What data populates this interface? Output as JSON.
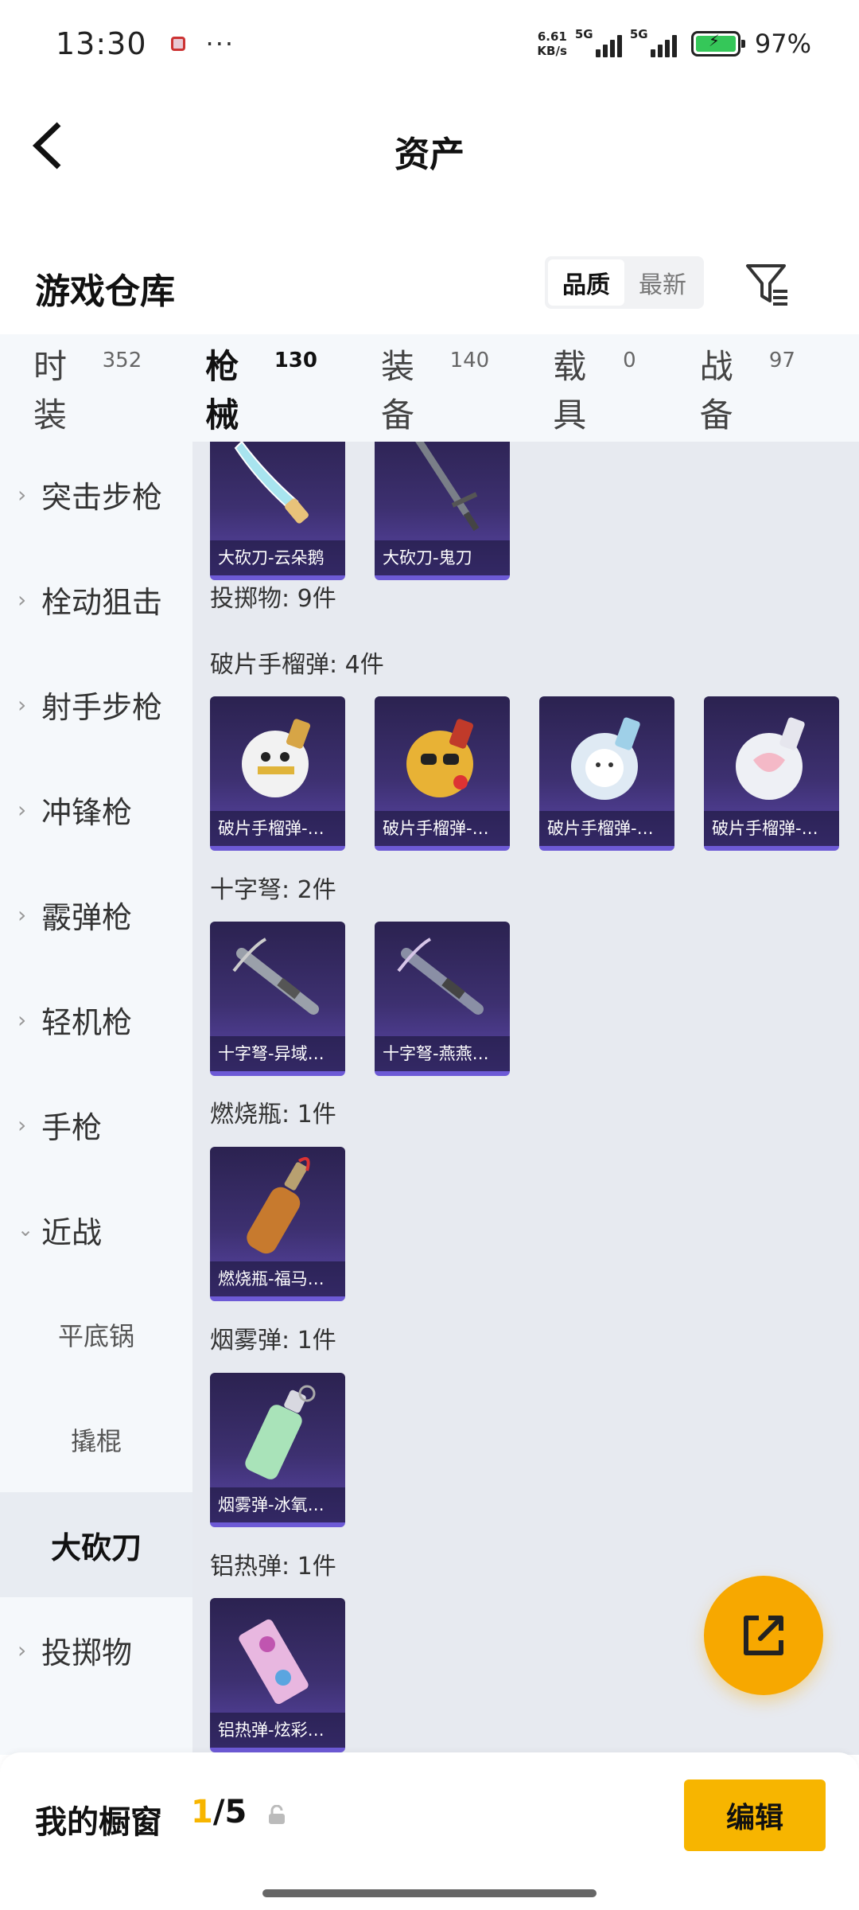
{
  "status_bar": {
    "time": "13:30",
    "dots": "···",
    "net_speed_value": "6.61",
    "net_speed_unit": "KB/s",
    "signal1_tag": "5G",
    "signal2_tag": "5G",
    "battery_pct": "97%"
  },
  "header": {
    "title": "资产"
  },
  "section": {
    "title": "游戏仓库",
    "sort_options": [
      "品质",
      "最新"
    ],
    "sort_selected": "品质"
  },
  "category_tabs": [
    {
      "name": "时装",
      "count": "352"
    },
    {
      "name": "枪械",
      "count": "130",
      "active": true
    },
    {
      "name": "装备",
      "count": "140"
    },
    {
      "name": "载具",
      "count": "0"
    },
    {
      "name": "战备",
      "count": "97"
    }
  ],
  "sidebar": {
    "items": [
      {
        "label": "突击步枪"
      },
      {
        "label": "栓动狙击"
      },
      {
        "label": "射手步枪"
      },
      {
        "label": "冲锋枪"
      },
      {
        "label": "霰弹枪"
      },
      {
        "label": "轻机枪"
      },
      {
        "label": "手枪"
      },
      {
        "label": "近战"
      },
      {
        "label": "投掷物"
      }
    ],
    "subitems": [
      {
        "label": "平底锅"
      },
      {
        "label": "撬棍"
      },
      {
        "label": "大砍刀",
        "active": true
      }
    ]
  },
  "content": {
    "top_cards": [
      "大砍刀-云朵鹅",
      "大砍刀-鬼刀"
    ],
    "throwables_header": "投掷物: 9件",
    "groups": [
      {
        "title": "破片手榴弹: 4件",
        "items": [
          "破片手榴弹-…",
          "破片手榴弹-…",
          "破片手榴弹-…",
          "破片手榴弹-…"
        ]
      },
      {
        "title": "十字弩: 2件",
        "items": [
          "十字弩-异域…",
          "十字弩-燕燕…"
        ]
      },
      {
        "title": "燃烧瓶: 1件",
        "items": [
          "燃烧瓶-福马…"
        ]
      },
      {
        "title": "烟雾弹: 1件",
        "items": [
          "烟雾弹-冰氧…"
        ]
      },
      {
        "title": "铝热弹: 1件",
        "items": [
          "铝热弹-炫彩…"
        ]
      }
    ]
  },
  "bottom_bar": {
    "title": "我的橱窗",
    "count_current": "1",
    "count_total": "/5",
    "edit_label": "编辑"
  },
  "icons": {
    "back": "back-arrow-icon",
    "filter": "filter-icon",
    "share": "share-export-icon",
    "lock": "lock-icon"
  },
  "colors": {
    "accent": "#f7b500",
    "card_top": "#2b2250",
    "card_bottom": "#5a46a8"
  }
}
